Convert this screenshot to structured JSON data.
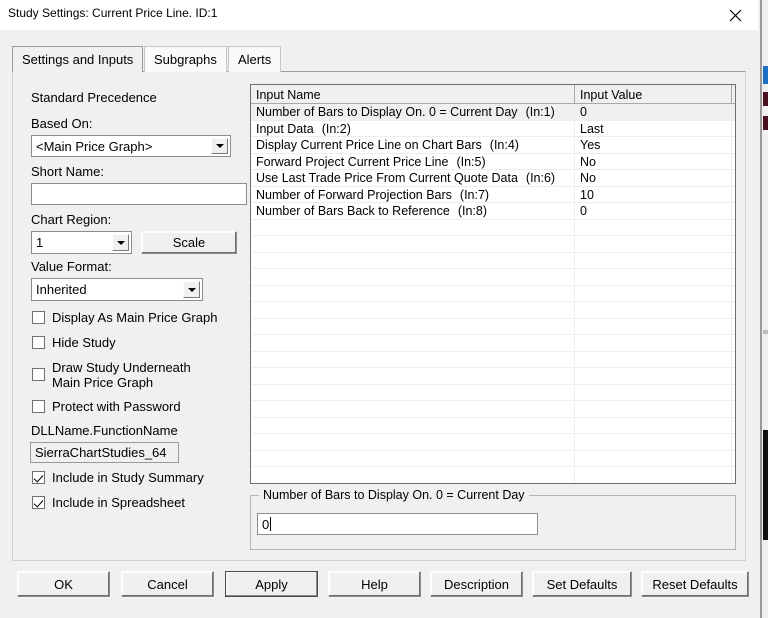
{
  "window": {
    "title": "Study Settings: Current Price Line. ID:1",
    "close_icon": "close-icon"
  },
  "tabs": [
    {
      "label": "Settings and Inputs",
      "active": true
    },
    {
      "label": "Subgraphs",
      "active": false
    },
    {
      "label": "Alerts",
      "active": false
    }
  ],
  "left_panel": {
    "standard_precedence": "Standard Precedence",
    "based_on_label": "Based On:",
    "based_on_value": "<Main Price Graph>",
    "short_name_label": "Short Name:",
    "short_name_value": "",
    "chart_region_label": "Chart Region:",
    "chart_region_value": "1",
    "scale_button": "Scale",
    "value_format_label": "Value Format:",
    "value_format_value": "Inherited",
    "checkboxes": [
      {
        "label": "Display As Main Price Graph",
        "checked": false
      },
      {
        "label": "Hide Study",
        "checked": false
      },
      {
        "label": "Draw Study Underneath\nMain Price Graph",
        "checked": false
      },
      {
        "label": "Protect with Password",
        "checked": false
      }
    ],
    "dll_label": "DLLName.FunctionName",
    "dll_value": "SierraChartStudies_64",
    "bottom_checkboxes": [
      {
        "label": "Include in Study Summary",
        "checked": true
      },
      {
        "label": "Include in Spreadsheet",
        "checked": true
      }
    ]
  },
  "inputs_table": {
    "headers": [
      "Input Name",
      "Input Value"
    ],
    "rows": [
      {
        "name": "Number of Bars to Display On. 0 = Current Day",
        "ref": "(In:1)",
        "value": "0",
        "selected": true
      },
      {
        "name": "Input Data",
        "ref": "(In:2)",
        "value": "Last",
        "selected": false
      },
      {
        "name": "Display Current Price Line on Chart Bars",
        "ref": "(In:4)",
        "value": "Yes",
        "selected": false
      },
      {
        "name": "Forward Project Current Price Line",
        "ref": "(In:5)",
        "value": "No",
        "selected": false
      },
      {
        "name": "Use Last Trade Price From Current Quote Data",
        "ref": "(In:6)",
        "value": "No",
        "selected": false
      },
      {
        "name": "Number of Forward Projection Bars",
        "ref": "(In:7)",
        "value": "10",
        "selected": false
      },
      {
        "name": "Number of Bars Back to Reference",
        "ref": "(In:8)",
        "value": "0",
        "selected": false
      }
    ],
    "empty_row_count": 17
  },
  "editor_group": {
    "legend": "Number of Bars to Display On. 0 = Current Day",
    "value": "0"
  },
  "buttons": [
    {
      "label": "OK",
      "default": false
    },
    {
      "label": "Cancel",
      "default": false
    },
    {
      "label": "Apply",
      "default": true
    },
    {
      "label": "Help",
      "default": false
    },
    {
      "label": "Description",
      "default": false
    },
    {
      "label": "Set Defaults",
      "default": false
    },
    {
      "label": "Reset Defaults",
      "default": false
    }
  ]
}
